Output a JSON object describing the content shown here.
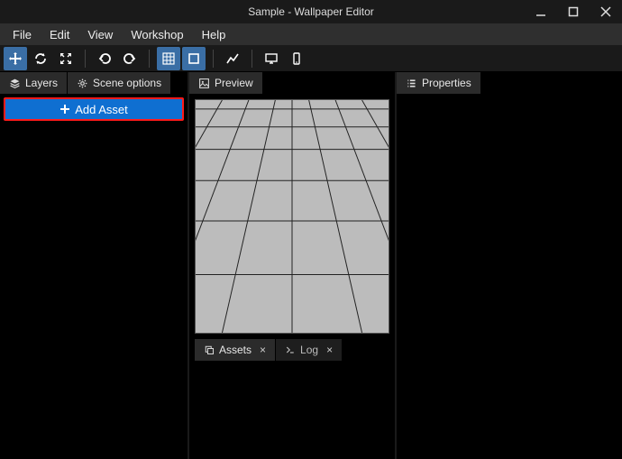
{
  "window": {
    "title": "Sample - Wallpaper Editor"
  },
  "menu": {
    "items": [
      "File",
      "Edit",
      "View",
      "Workshop",
      "Help"
    ]
  },
  "left_panel": {
    "tabs": [
      {
        "label": "Layers"
      },
      {
        "label": "Scene options"
      }
    ],
    "add_asset": "Add Asset"
  },
  "mid_panel": {
    "preview_tab": "Preview",
    "bottom_tabs": [
      {
        "label": "Assets"
      },
      {
        "label": "Log"
      }
    ]
  },
  "right_panel": {
    "properties_tab": "Properties"
  }
}
